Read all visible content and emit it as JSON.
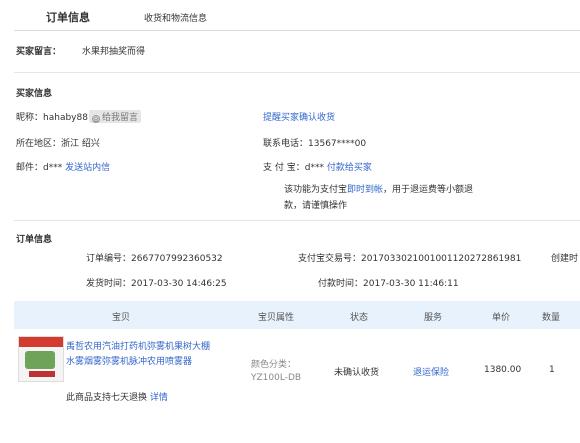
{
  "tabs": {
    "active": "订单信息",
    "inactive": "收货和物流信息"
  },
  "buyer_message": {
    "label": "买家留言：",
    "value": "水果邦抽奖而得"
  },
  "buyer_info": {
    "title": "买家信息",
    "nickname_label": "昵称：",
    "nickname": "hahaby88",
    "send_message": "给我留言",
    "remind_link": "提醒买家确认收货",
    "region_label": "所在地区：",
    "region": "浙江 绍兴",
    "phone_label": "联系电话：",
    "phone": "13567****00",
    "email_label": "邮件：",
    "email": "d***",
    "email_link": "发送站内信",
    "alipay_label": "支 付 宝：",
    "alipay": "d***",
    "alipay_link": "付款给买家",
    "note_pre": "该功能为支付宝",
    "note_link": "即时到帐",
    "note_post": "，用于退运费等小额退",
    "note_line2": "款，请谨慎操作"
  },
  "order_info": {
    "title": "订单信息",
    "order_no_label": "订单编号：",
    "order_no": "2667707992360532",
    "alipay_trade_label": "支付宝交易号：",
    "alipay_trade": "2017033021001001120272861981",
    "created_label": "创建时",
    "ship_time_label": "发货时间：",
    "ship_time": "2017-03-30 14:46:25",
    "pay_time_label": "付款时间：",
    "pay_time": "2017-03-30 11:46:11"
  },
  "table": {
    "headers": [
      "宝贝",
      "宝贝属性",
      "状态",
      "服务",
      "单价",
      "数量"
    ],
    "row": {
      "title_line1": "禹哲农用汽油打药机弥雾机果树大棚",
      "title_line2": "水雾烟雾弥雾机脉冲农用喷雾器",
      "attr_label": "颜色分类：",
      "attr_value": "YZ100L-DB",
      "status": "未确认收货",
      "service": "退运保险",
      "price": "1380.00",
      "qty": "1",
      "promise": "七天退换",
      "promise_pre": "此商品支持",
      "promise_link": "详情"
    }
  },
  "colors": {
    "link": "#3366cc",
    "header_bg": "#e8f2fc"
  }
}
